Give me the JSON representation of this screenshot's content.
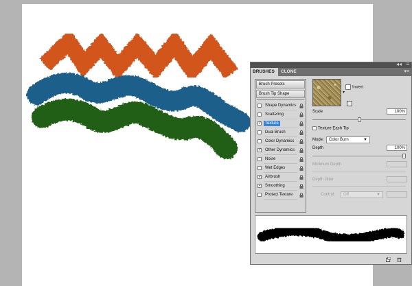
{
  "panel": {
    "tabs": [
      "BRUSHES",
      "CLONE SOURCE"
    ],
    "header_double_arrow": "◂◂",
    "header_menu_icon": "≡",
    "tab_options_icon": "▾≡",
    "presets_button": "Brush Presets",
    "tip_shape": "Brush Tip Shape",
    "options": [
      {
        "label": "Shape Dynamics",
        "checked": false
      },
      {
        "label": "Scattering",
        "checked": false
      },
      {
        "label": "Texture",
        "checked": true,
        "selected": true
      },
      {
        "label": "Dual Brush",
        "checked": false
      },
      {
        "label": "Color Dynamics",
        "checked": false
      },
      {
        "label": "Other Dynamics",
        "checked": true
      },
      {
        "label": "Noise",
        "checked": false
      },
      {
        "label": "Wet Edges",
        "checked": false
      },
      {
        "label": "Airbrush",
        "checked": true
      },
      {
        "label": "Smoothing",
        "checked": true
      },
      {
        "label": "Protect Texture",
        "checked": false
      }
    ],
    "texture": {
      "invert_label": "Invert",
      "scale_label": "Scale",
      "scale_value": "100%",
      "scale_slider_fraction": 0.5,
      "texture_each_tip_label": "Texture Each Tip",
      "mode_label": "Mode:",
      "mode_value": "Color Burn",
      "depth_label": "Depth",
      "depth_value": "100%",
      "depth_slider_fraction": 1.0,
      "minimum_depth_label": "Minimum Depth",
      "depth_jitter_label": "Depth Jitter",
      "control_label": "Control:",
      "control_value": "Off"
    }
  },
  "colors": {
    "stroke_orange": "#d2571f",
    "stroke_blue": "#1e5e8a",
    "stroke_green": "#245e12",
    "selection_blue": "#3c83d6"
  }
}
